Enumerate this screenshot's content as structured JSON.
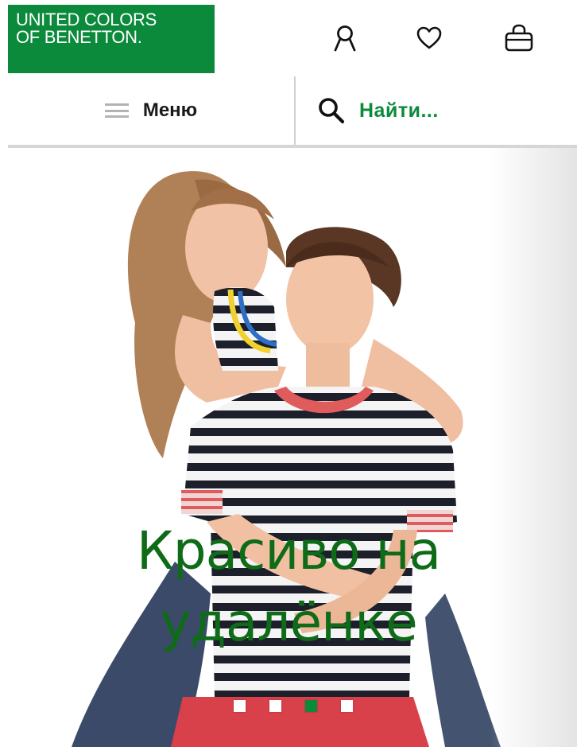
{
  "header": {
    "logo_line1": "UNITED COLORS",
    "logo_line2": "OF BENETTON.",
    "brand_color": "#0b8a3c",
    "icons": [
      "account-icon",
      "heart-icon",
      "shopping-bag-icon"
    ]
  },
  "nav": {
    "menu_label": "Меню",
    "menu_icon": "hamburger-icon",
    "search_label": "Найти...",
    "search_icon": "search-icon"
  },
  "hero": {
    "title_line1": "Красиво на",
    "title_line2": "удалёнке",
    "title_color": "#0e6b17",
    "carousel_slide_count": 4,
    "carousel_active_index": 2
  }
}
